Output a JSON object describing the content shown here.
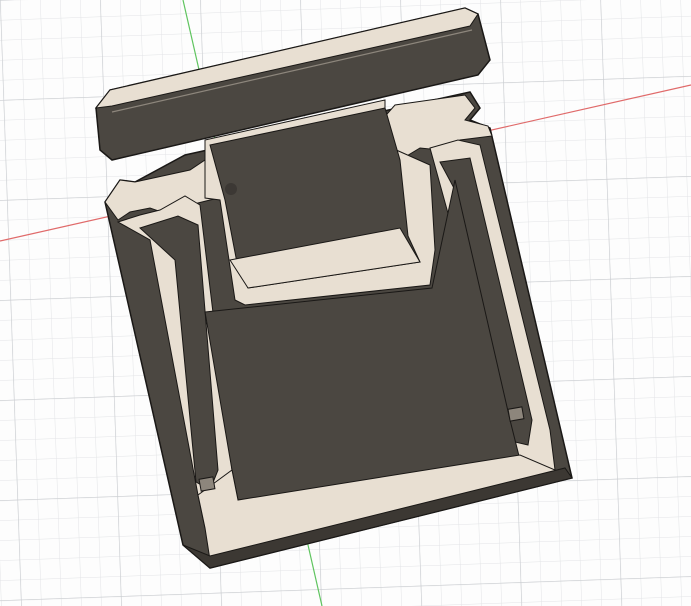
{
  "viewport": {
    "background": "#fdfdfd",
    "grid_minor_color": "#e2e4e6",
    "grid_major_color": "#c9ccd0"
  },
  "axes": {
    "x_axis_color": "#e06a6a",
    "y_axis_color": "#5fc45f",
    "origin_marker_color": "#3a3632"
  },
  "model": {
    "dark_face_color": "#4b4741",
    "dark_face_shadow_color": "#3c3833",
    "cut_face_color": "#e8dfd2",
    "edge_color": "#1a1816"
  }
}
